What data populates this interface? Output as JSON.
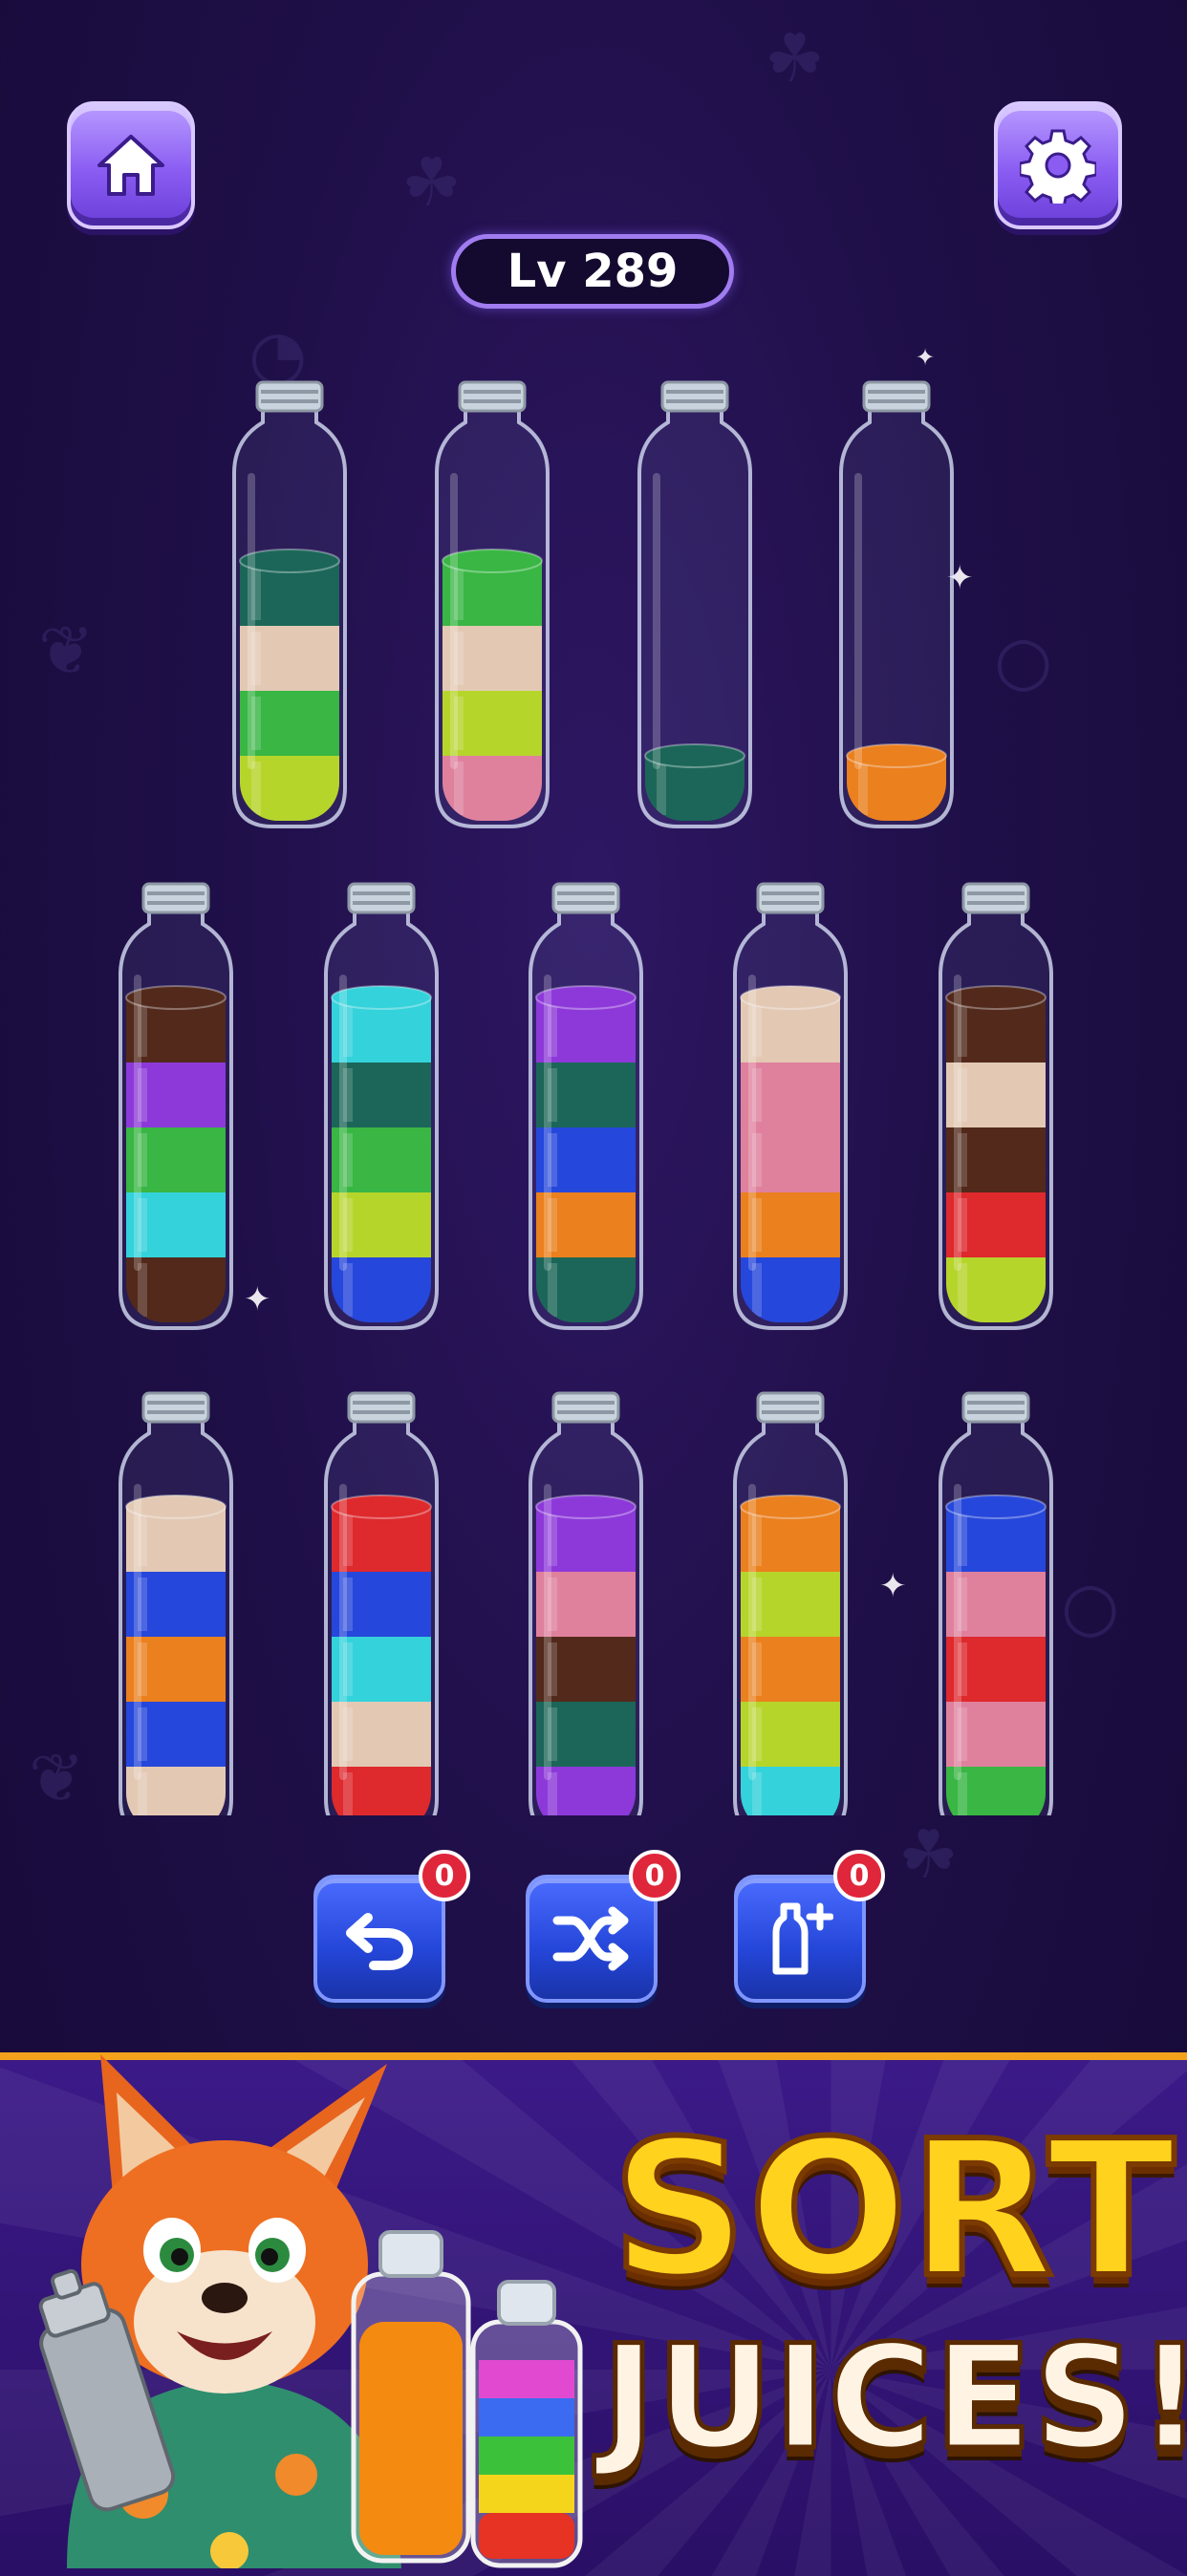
{
  "header": {
    "home_icon": "home-icon",
    "settings_icon": "gear-icon",
    "level_label": "Lv 289"
  },
  "colors": {
    "teal_dark": "#0f5e4a",
    "beige": "#e8c9ae",
    "green": "#2fb534",
    "lime": "#b7d61a",
    "pink": "#e37b95",
    "orange": "#f07a0b",
    "brown": "#4a1c08",
    "purple": "#8a2dd6",
    "cyan": "#2ad3d8",
    "blue": "#1b3cd8",
    "red": "#e21c1c"
  },
  "bottles": [
    {
      "row": 0,
      "layers": [
        "lime",
        "green",
        "beige",
        "teal_dark"
      ]
    },
    {
      "row": 0,
      "layers": [
        "pink",
        "lime",
        "beige",
        "green"
      ]
    },
    {
      "row": 0,
      "layers": [
        "teal_dark"
      ]
    },
    {
      "row": 0,
      "layers": [
        "orange"
      ]
    },
    {
      "row": 1,
      "layers": [
        "brown",
        "cyan",
        "green",
        "purple",
        "brown"
      ]
    },
    {
      "row": 1,
      "layers": [
        "blue",
        "lime",
        "green",
        "teal_dark",
        "cyan"
      ]
    },
    {
      "row": 1,
      "layers": [
        "teal_dark",
        "orange",
        "blue",
        "teal_dark",
        "purple"
      ]
    },
    {
      "row": 1,
      "layers": [
        "blue",
        "orange",
        "pink",
        "pink",
        "beige"
      ]
    },
    {
      "row": 1,
      "layers": [
        "lime",
        "red",
        "brown",
        "beige",
        "brown"
      ]
    },
    {
      "row": 2,
      "layers": [
        "beige",
        "blue",
        "orange",
        "blue",
        "beige"
      ]
    },
    {
      "row": 2,
      "layers": [
        "red",
        "beige",
        "cyan",
        "blue",
        "red"
      ]
    },
    {
      "row": 2,
      "layers": [
        "purple",
        "teal_dark",
        "brown",
        "pink",
        "purple"
      ]
    },
    {
      "row": 2,
      "layers": [
        "cyan",
        "lime",
        "orange",
        "lime",
        "orange"
      ]
    },
    {
      "row": 2,
      "layers": [
        "green",
        "pink",
        "red",
        "pink",
        "blue"
      ]
    }
  ],
  "actions": [
    {
      "name": "undo-button",
      "icon": "undo-icon",
      "count": "0"
    },
    {
      "name": "shuffle-button",
      "icon": "shuffle-icon",
      "count": "0"
    },
    {
      "name": "add-bottle-button",
      "icon": "add-bottle-icon",
      "count": "0"
    }
  ],
  "banner": {
    "title_line1": "SORT",
    "title_line2": "JUICES!",
    "mascot": "fox-mascot-illustration",
    "accent": "#f3a21b"
  }
}
